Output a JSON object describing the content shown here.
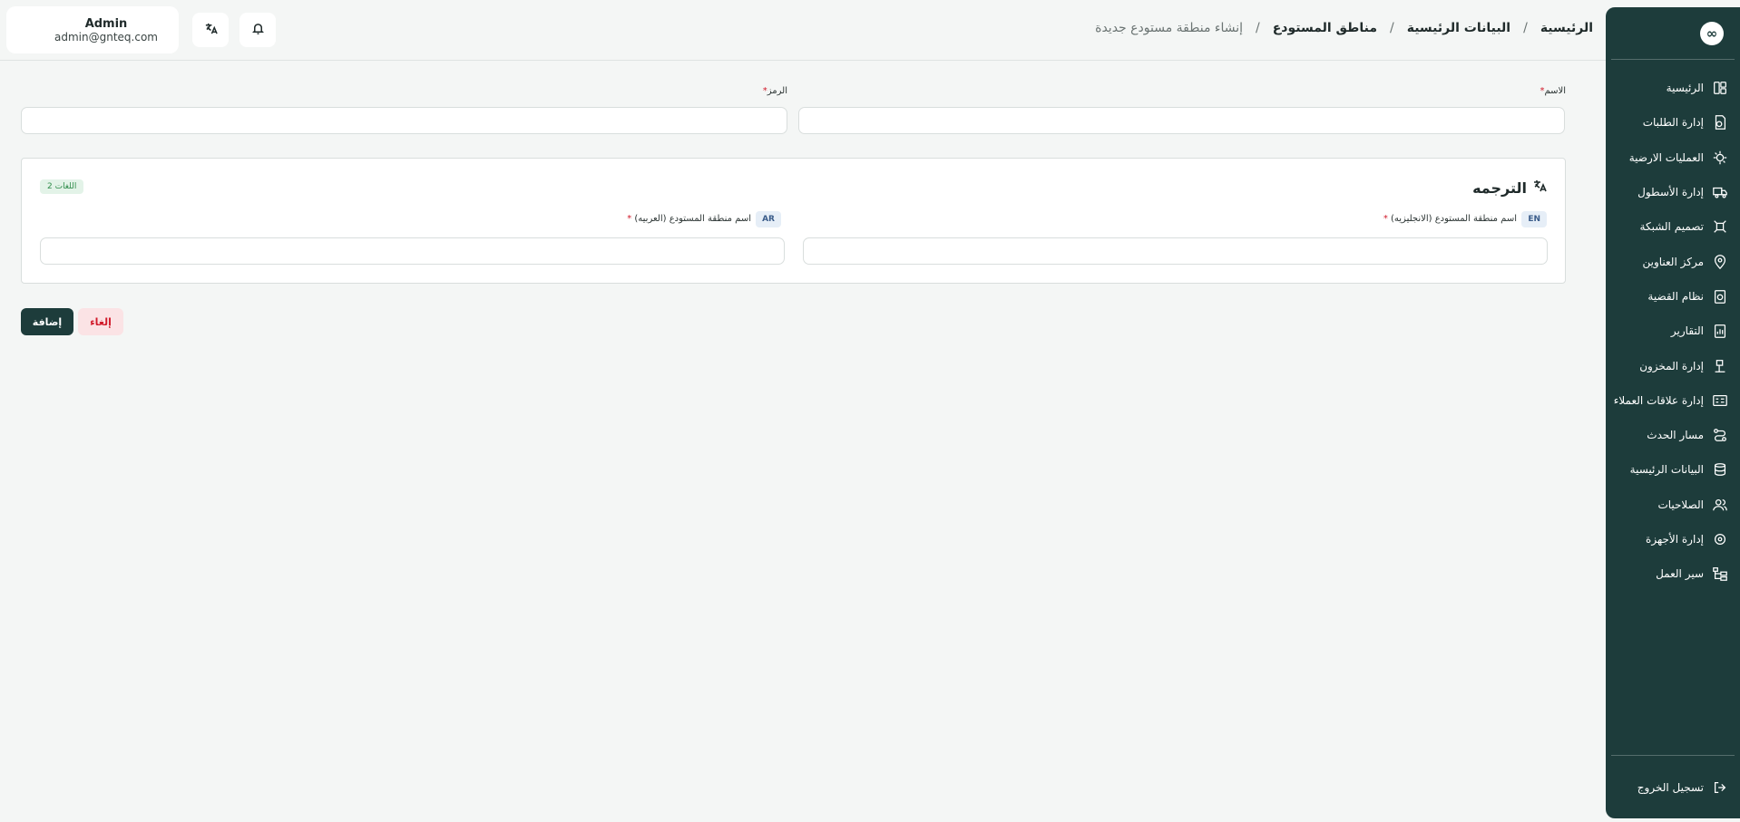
{
  "header": {
    "breadcrumb": [
      "الرئيسية",
      "البيانات الرئيسية",
      "مناطق المستودع",
      "إنشاء منطقة مستودع جديدة"
    ],
    "separator": "/",
    "user_name": "Admin",
    "user_email": "admin@gnteq.com"
  },
  "sidebar": {
    "logo": "∞",
    "items": [
      {
        "label": "الرئيسية",
        "icon": "dashboard-icon"
      },
      {
        "label": "إدارة الطلبات",
        "icon": "orders-icon"
      },
      {
        "label": "العمليات الارضية",
        "icon": "ground-operations-icon"
      },
      {
        "label": "إدارة الأسطول",
        "icon": "fleet-truck-icon"
      },
      {
        "label": "تصميم الشبكة",
        "icon": "network-icon"
      },
      {
        "label": "مركز العناوين",
        "icon": "location-pin-icon"
      },
      {
        "label": "نظام القضية",
        "icon": "case-file-icon"
      },
      {
        "label": "التقارير",
        "icon": "reports-icon"
      },
      {
        "label": "إدارة المخزون",
        "icon": "inventory-icon"
      },
      {
        "label": "إدارة علاقات العملاء",
        "icon": "crm-icon"
      },
      {
        "label": "مسار الحدث",
        "icon": "event-route-icon"
      },
      {
        "label": "البيانات الرئيسية",
        "icon": "database-icon"
      },
      {
        "label": "الصلاحيات",
        "icon": "users-icon"
      },
      {
        "label": "إدارة الأجهزة",
        "icon": "device-gear-icon"
      },
      {
        "label": "سير العمل",
        "icon": "workflow-icon"
      }
    ],
    "logout": "تسجيل الخروج"
  },
  "form": {
    "name_label": "الاسم",
    "code_label": "الرمز",
    "required_mark": "*",
    "name_value": "",
    "code_value": ""
  },
  "translation": {
    "title": "الترجمه",
    "languages_badge": "2 اللغات",
    "en_tag": "EN",
    "en_label": "اسم منطقة المستودع (الانجليزيه)",
    "ar_tag": "AR",
    "ar_label": "اسم منطقة المستودع (العربيه)",
    "en_value": "",
    "ar_value": ""
  },
  "actions": {
    "add": "إضافة",
    "cancel": "إلغاء"
  },
  "colors": {
    "sidebar_bg": "#1d3c3b",
    "primary": "#1d3c3b",
    "danger": "#d11a2a",
    "page_bg": "#f4f6f5"
  }
}
